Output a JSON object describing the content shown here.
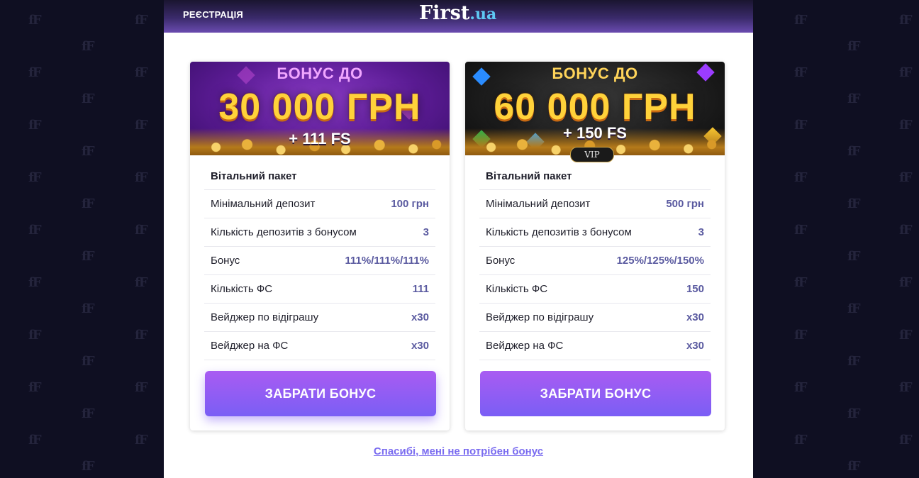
{
  "header": {
    "registration_link": "РЕЄСТРАЦІЯ",
    "logo_main": "First",
    "logo_tld": ".ua"
  },
  "cards": [
    {
      "banner_top": "БОНУС ДО",
      "banner_amount": "30 000 ГРН",
      "banner_fs": "+ 111 FS",
      "package_title": "Вітальний пакет",
      "rows": [
        {
          "label": "Мінімальний депозит",
          "value": "100 грн"
        },
        {
          "label": "Кількість депозитів з бонусом",
          "value": "3"
        },
        {
          "label": "Бонус",
          "value": "111%/111%/111%"
        },
        {
          "label": "Кількість ФС",
          "value": "111"
        },
        {
          "label": "Вейджер по відіграшу",
          "value": "x30"
        },
        {
          "label": "Вейджер на ФС",
          "value": "x30"
        }
      ],
      "button_label": "ЗАБРАТИ БОНУС"
    },
    {
      "banner_top": "БОНУС ДО",
      "banner_amount": "60 000 ГРН",
      "banner_fs": "+ 150 FS",
      "vip_badge": "VIP",
      "package_title": "Вітальний пакет",
      "rows": [
        {
          "label": "Мінімальний депозит",
          "value": "500 грн"
        },
        {
          "label": "Кількість депозитів з бонусом",
          "value": "3"
        },
        {
          "label": "Бонус",
          "value": "125%/125%/150%"
        },
        {
          "label": "Кількість ФС",
          "value": "150"
        },
        {
          "label": "Вейджер по відіграшу",
          "value": "x30"
        },
        {
          "label": "Вейджер на ФС",
          "value": "x30"
        }
      ],
      "button_label": "ЗАБРАТИ БОНУС"
    }
  ],
  "decline_link": "Спасибі, мені не потрібен бонус",
  "colors": {
    "accent": "#7a5ef5",
    "value_text": "#5a5aa0",
    "link": "#7a6cf0",
    "page_bg": "#0f0f22"
  }
}
